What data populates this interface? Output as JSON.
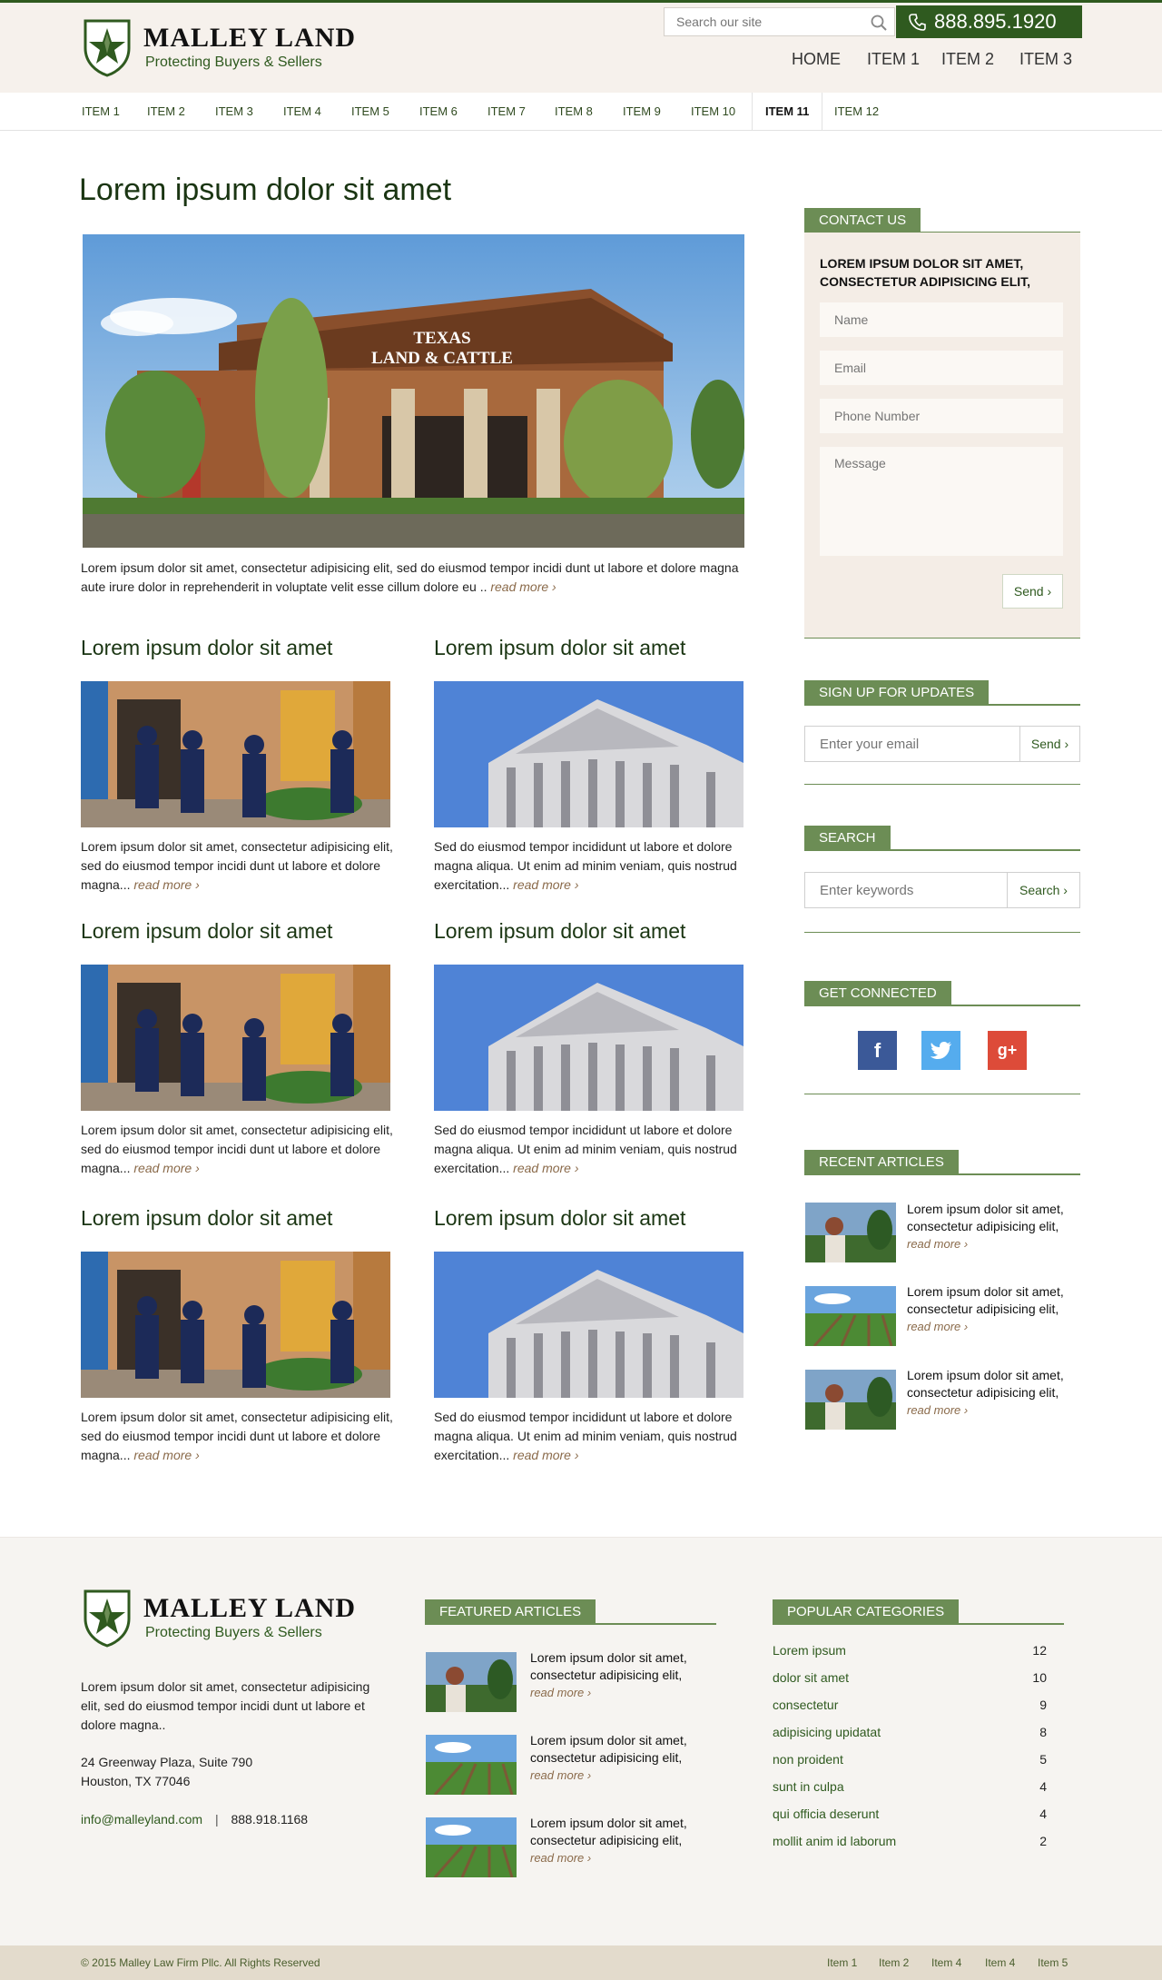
{
  "brand": {
    "name": "MALLEY LAND",
    "tagline": "Protecting Buyers & Sellers"
  },
  "header": {
    "search_placeholder": "Search our site",
    "phone": "888.895.1920",
    "nav": [
      "HOME",
      "ITEM 1",
      "ITEM 2",
      "ITEM 3"
    ]
  },
  "subnav": {
    "items": [
      "ITEM 1",
      "ITEM 2",
      "ITEM 3",
      "ITEM 4",
      "ITEM 5",
      "ITEM 6",
      "ITEM 7",
      "ITEM 8",
      "ITEM 9",
      "ITEM 10",
      "ITEM 11",
      "ITEM 12"
    ],
    "active": "ITEM 11"
  },
  "main": {
    "title": "Lorem ipsum dolor sit amet",
    "hero_text": "Lorem ipsum dolor sit amet, consectetur adipisicing elit, sed do eiusmod tempor incidi dunt ut labore et dolore magna aute irure dolor in reprehenderit in voluptate velit esse cillum dolore eu ..",
    "read_more": "read more ›",
    "hero_sign_line1": "TEXAS",
    "hero_sign_line2": "LAND & CATTLE",
    "articles": [
      {
        "title": "Lorem ipsum dolor sit amet",
        "text": "Lorem ipsum dolor sit amet, consectetur adipisicing elit, sed do eiusmod tempor incidi dunt ut labore et dolore magna..."
      },
      {
        "title": "Lorem ipsum dolor sit amet",
        "text": "Sed do eiusmod tempor incididunt ut labore et dolore magna aliqua. Ut enim ad minim veniam, quis nostrud exercitation..."
      },
      {
        "title": "Lorem ipsum dolor sit amet",
        "text": "Lorem ipsum dolor sit amet, consectetur adipisicing elit, sed do eiusmod tempor incidi dunt ut labore et dolore magna..."
      },
      {
        "title": "Lorem ipsum dolor sit amet",
        "text": "Sed do eiusmod tempor incididunt ut labore et dolore magna aliqua. Ut enim ad minim veniam, quis nostrud exercitation..."
      },
      {
        "title": "Lorem ipsum dolor sit amet",
        "text": "Lorem ipsum dolor sit amet, consectetur adipisicing elit, sed do eiusmod tempor incidi dunt ut labore et dolore magna..."
      },
      {
        "title": "Lorem ipsum dolor sit amet",
        "text": "Sed do eiusmod tempor incididunt ut labore et dolore magna aliqua. Ut enim ad minim veniam, quis nostrud exercitation..."
      }
    ]
  },
  "sidebar": {
    "contact": {
      "heading": "CONTACT US",
      "lead": "LOREM IPSUM DOLOR SIT AMET, CONSECTETUR ADIPISICING ELIT,",
      "name_placeholder": "Name",
      "email_placeholder": "Email",
      "phone_placeholder": "Phone Number",
      "message_placeholder": "Message",
      "send": "Send ›"
    },
    "signup": {
      "heading": "SIGN UP FOR UPDATES",
      "placeholder": "Enter your email",
      "button": "Send ›"
    },
    "search": {
      "heading": "SEARCH",
      "placeholder": "Enter keywords",
      "button": "Search ›"
    },
    "connected": {
      "heading": "GET CONNECTED",
      "facebook": "f",
      "google": "g+"
    },
    "recent": {
      "heading": "RECENT ARTICLES",
      "items": [
        {
          "text": "Lorem ipsum dolor sit amet, consectetur adipisicing elit,"
        },
        {
          "text": "Lorem ipsum dolor sit amet, consectetur adipisicing elit,"
        },
        {
          "text": "Lorem ipsum dolor sit amet, consectetur adipisicing elit,"
        }
      ]
    }
  },
  "footer": {
    "about": "Lorem ipsum dolor sit amet, consectetur adipisicing elit, sed do eiusmod tempor incidi dunt ut labore et dolore magna..",
    "address1": "24 Greenway Plaza, Suite 790",
    "address2": "Houston, TX 77046",
    "email": "info@malleyland.com",
    "separator": "|",
    "phone": "888.918.1168",
    "featured_heading": "FEATURED ARTICLES",
    "featured": [
      {
        "text": "Lorem ipsum dolor sit amet, consectetur adipisicing elit,"
      },
      {
        "text": "Lorem ipsum dolor sit amet, consectetur adipisicing elit,"
      },
      {
        "text": "Lorem ipsum dolor sit amet, consectetur adipisicing elit,"
      }
    ],
    "categories_heading": "POPULAR CATEGORIES",
    "categories": [
      {
        "name": "Lorem ipsum",
        "count": "12"
      },
      {
        "name": "dolor sit amet",
        "count": "10"
      },
      {
        "name": "consectetur",
        "count": "9"
      },
      {
        "name": "adipisicing upidatat",
        "count": "8"
      },
      {
        "name": "non proident",
        "count": "5"
      },
      {
        "name": "sunt in culpa",
        "count": "4"
      },
      {
        "name": "qui officia deserunt",
        "count": "4"
      },
      {
        "name": "mollit anim id laborum",
        "count": "2"
      }
    ]
  },
  "bottom": {
    "copyright": "© 2015 Malley Law Firm Pllc. All Rights Reserved",
    "links": [
      "Item 1",
      "Item 2",
      "Item 4",
      "Item 4",
      "Item 5"
    ]
  },
  "colors": {
    "brand_green": "#2f5a1f",
    "accent_green": "#6c8d55",
    "header_bg": "#f6f1ec",
    "read_more": "#8a6a4a",
    "facebook": "#3b5998",
    "twitter": "#55acee",
    "google": "#dd4b39"
  },
  "icons": {
    "logo": "star-shield-icon",
    "search": "search-icon",
    "phone": "phone-icon",
    "facebook": "facebook-icon",
    "twitter": "twitter-icon",
    "google": "google-plus-icon"
  }
}
